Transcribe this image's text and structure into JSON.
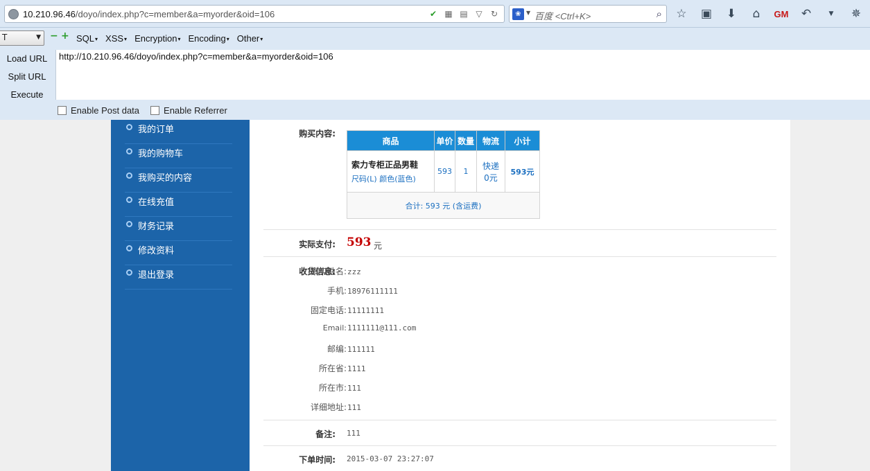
{
  "browser": {
    "url_host": "10.210.96.46",
    "url_path": "/doyo/index.php?c=member&a=myorder&oid=106",
    "search_placeholder": "百度 <Ctrl+K>",
    "gm_icon_text": "GM"
  },
  "hackbar": {
    "select_value": "T",
    "menu": [
      "SQL",
      "XSS",
      "Encryption",
      "Encoding",
      "Other"
    ],
    "buttons": [
      "Load URL",
      "Split URL",
      "Execute"
    ],
    "url_text": "http://10.210.96.46/doyo/index.php?c=member&a=myorder&oid=106",
    "enable_post": "Enable Post data",
    "enable_referrer": "Enable Referrer"
  },
  "sidebar": {
    "items": [
      "我的订单",
      "我的购物车",
      "我购买的内容",
      "在线充值",
      "财务记录",
      "修改资料",
      "退出登录"
    ]
  },
  "order": {
    "content_label": "购买内容:",
    "table_headers": [
      "商品",
      "单价",
      "数量",
      "物流",
      "小计"
    ],
    "product_name": "索力专柜正品男鞋",
    "product_spec": "尺码(L) 颜色(蓝色)",
    "unit_price": "593",
    "quantity": "1",
    "shipping_method": "快递",
    "shipping_fee": "0元",
    "subtotal": "593元",
    "total": "合计: 593 元 (含运费)",
    "paid_label": "实际支付:",
    "paid_amount": "593",
    "paid_unit": "元",
    "receiver_label": "收货信息:",
    "receiver": {
      "name_k": "真实姓名:",
      "name_v": "zzz",
      "mobile_k": "手机:",
      "mobile_v": "18976111111",
      "phone_k": "固定电话:",
      "phone_v": "11111111",
      "email_k": "Email:",
      "email_v": "1111111@111.com",
      "zip_k": "邮编:",
      "zip_v": "111111",
      "province_k": "所在省:",
      "province_v": "1111",
      "city_k": "所在市:",
      "city_v": "111",
      "address_k": "详细地址:",
      "address_v": "111"
    },
    "note_label": "备注:",
    "note_value": "111",
    "time_label": "下单时间:",
    "time_value": "2015-03-07 23:27:07"
  }
}
